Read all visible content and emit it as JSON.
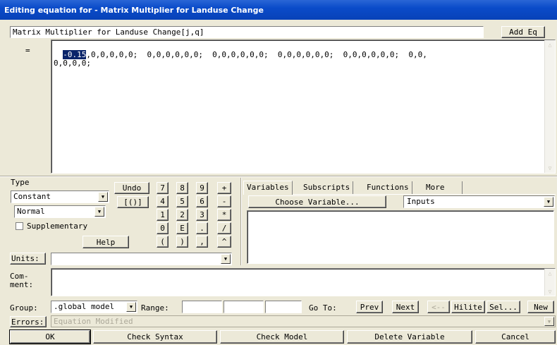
{
  "window": {
    "title": "Editing equation for - Matrix Multiplier for Landuse Change"
  },
  "equation": {
    "name": "Matrix Multiplier for Landuse Change[j,q]",
    "add_eq_label": "Add Eq",
    "equals_label": "=",
    "selected_text": "-0.15",
    "text_line1_rest": ",0,0,0,0,0;  0,0,0,0,0,0;  0,0,0,0,0,0;  0,0,0,0,0,0;  0,0,0,0,0,0;  0,0,",
    "text_line2": "0,0,0,0;"
  },
  "type_panel": {
    "type_label": "Type",
    "type_value": "Constant",
    "subtype_value": "Normal",
    "supplementary_label": "Supplementary",
    "supplementary_checked": false,
    "undo_label": "Undo",
    "brackets_label": "[()]",
    "help_label": "Help"
  },
  "keypad": [
    "7",
    "8",
    "9",
    "+",
    "4",
    "5",
    "6",
    "-",
    "1",
    "2",
    "3",
    "*",
    "0",
    "E",
    ".",
    "/",
    "(",
    ")",
    ",",
    "^"
  ],
  "tabs": [
    {
      "label": "Variables",
      "active": true
    },
    {
      "label": "Subscripts",
      "active": false
    },
    {
      "label": "Functions",
      "active": false
    },
    {
      "label": "More",
      "active": false
    }
  ],
  "variables": {
    "choose_label": "Choose Variable...",
    "filter_value": "Inputs"
  },
  "units": {
    "label": "Units:",
    "value": ""
  },
  "comment": {
    "label_line1": "Com-",
    "label_line2": "ment:"
  },
  "group_row": {
    "group_label": "Group:",
    "group_value": ".global model",
    "range_label": "Range:",
    "goto_label": "Go To:",
    "prev_label": "Prev",
    "next_label": "Next",
    "back_label": "<--",
    "hilite_label": "Hilite",
    "sel_label": "Sel...",
    "new_label": "New"
  },
  "errors": {
    "label": "Errors:",
    "value": "Equation Modified"
  },
  "bottom_buttons": {
    "ok": "OK",
    "check_syntax": "Check Syntax",
    "check_model": "Check Model",
    "delete_variable": "Delete Variable",
    "cancel": "Cancel"
  },
  "colors": {
    "title_bar": "#0a4bc9",
    "face": "#ece9d8",
    "selection": "#0a246a"
  }
}
